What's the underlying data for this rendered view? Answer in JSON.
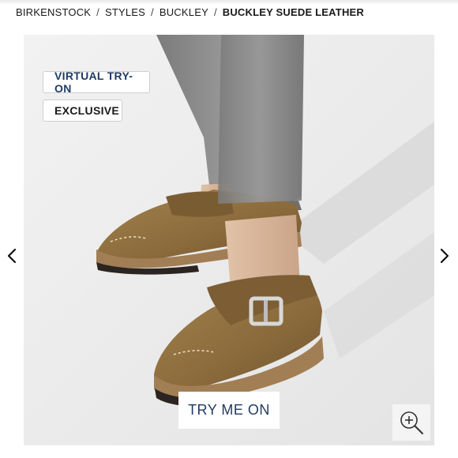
{
  "breadcrumb": {
    "items": [
      "BIRKENSTOCK",
      "STYLES",
      "BUCKLEY"
    ],
    "separator": "/",
    "current": "BUCKLEY SUEDE LEATHER"
  },
  "badges": {
    "virtual_try_on": "VIRTUAL TRY-ON",
    "exclusive": "EXCLUSIVE"
  },
  "gallery": {
    "try_me_on": "TRY ME ON",
    "icons": {
      "prev": "chevron-left-icon",
      "next": "chevron-right-icon",
      "zoom": "zoom-in-icon"
    }
  },
  "colors": {
    "accent_navy": "#1f3b63",
    "suede": "#8a6a3b",
    "cork": "#a27e55",
    "pants": "#8c8c8c"
  }
}
